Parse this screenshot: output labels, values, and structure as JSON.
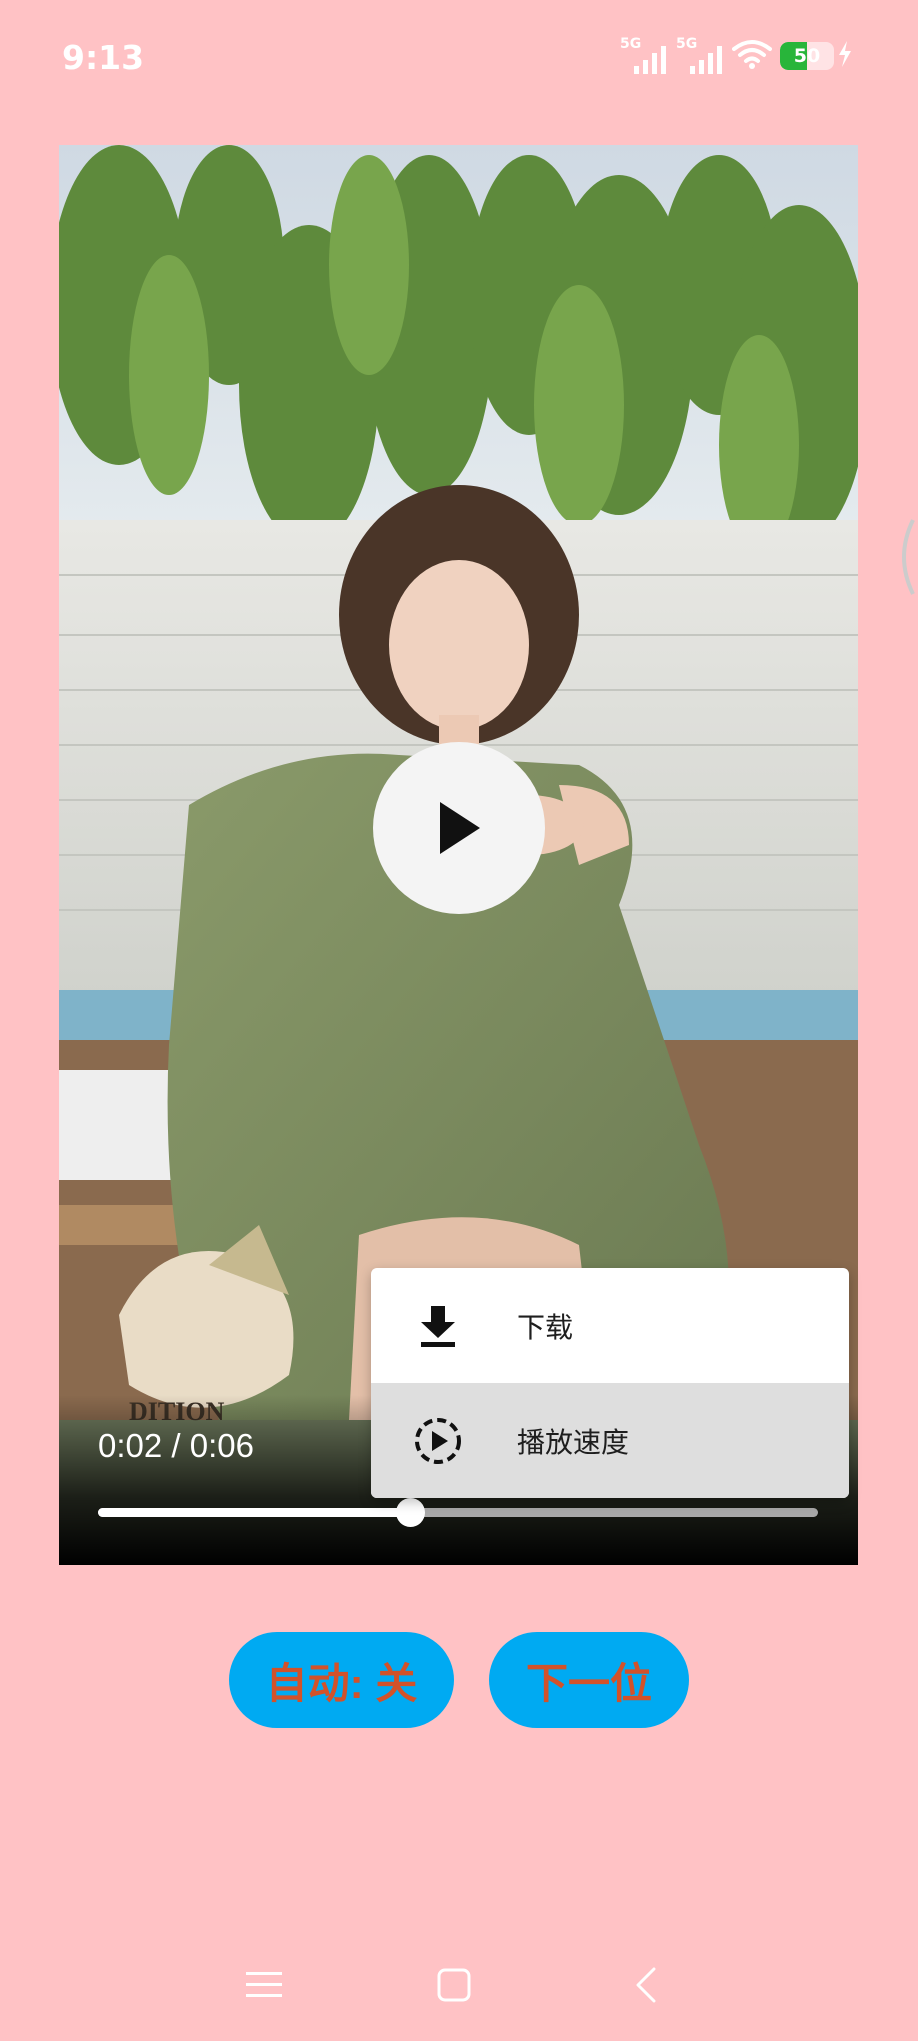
{
  "status_bar": {
    "time": "9:13",
    "network_1": "5G",
    "network_2": "5G",
    "battery_level": "50",
    "icons": [
      "signal-icon",
      "signal-icon",
      "wifi-icon",
      "battery-icon",
      "charging-icon"
    ]
  },
  "player": {
    "current_time": "0:02",
    "total_time": "0:06",
    "separator": " / ",
    "time_display": "0:02 / 0:06",
    "progress_fraction": 0.433,
    "play_icon": "play-icon"
  },
  "menu": {
    "items": [
      {
        "label": "下载",
        "icon": "download-icon",
        "selected": false
      },
      {
        "label": "播放速度",
        "icon": "playback-speed-icon",
        "selected": true
      }
    ]
  },
  "controls": {
    "auto_label": "自动: 关",
    "next_label": "下一位"
  },
  "colors": {
    "background": "#ffc2c5",
    "button_bg": "#00aaf2",
    "button_text": "#d2522a",
    "menu_selected": "#dedede"
  },
  "nav_bar": {
    "icons": [
      "menu-icon",
      "home-icon",
      "back-icon"
    ]
  }
}
